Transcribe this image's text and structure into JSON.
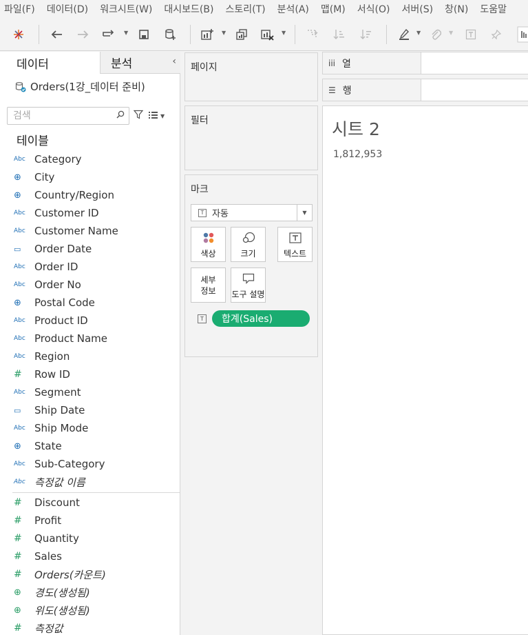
{
  "menu": [
    "파일(F)",
    "데이터(D)",
    "워크시트(W)",
    "대시보드(B)",
    "스토리(T)",
    "분석(A)",
    "맵(M)",
    "서식(O)",
    "서버(S)",
    "창(N)",
    "도움말"
  ],
  "data_pane": {
    "tab_data": "데이터",
    "tab_analysis": "분석",
    "datasource": "Orders(1강_데이터 준비)",
    "search_placeholder": "검색",
    "table_heading": "테이블",
    "dimensions": [
      {
        "icon": "Abc",
        "label": "Category"
      },
      {
        "icon": "⊕",
        "label": "City"
      },
      {
        "icon": "⊕",
        "label": "Country/Region"
      },
      {
        "icon": "Abc",
        "label": "Customer ID"
      },
      {
        "icon": "Abc",
        "label": "Customer Name"
      },
      {
        "icon": "▭",
        "label": "Order Date"
      },
      {
        "icon": "Abc",
        "label": "Order ID"
      },
      {
        "icon": "Abc",
        "label": "Order No"
      },
      {
        "icon": "⊕",
        "label": "Postal Code"
      },
      {
        "icon": "Abc",
        "label": "Product ID"
      },
      {
        "icon": "Abc",
        "label": "Product Name"
      },
      {
        "icon": "Abc",
        "label": "Region"
      },
      {
        "icon": "#",
        "label": "Row ID"
      },
      {
        "icon": "Abc",
        "label": "Segment"
      },
      {
        "icon": "▭",
        "label": "Ship Date"
      },
      {
        "icon": "Abc",
        "label": "Ship Mode"
      },
      {
        "icon": "⊕",
        "label": "State"
      },
      {
        "icon": "Abc",
        "label": "Sub-Category"
      },
      {
        "icon": "Abc",
        "label": "측정값 이름"
      }
    ],
    "measures": [
      {
        "icon": "#",
        "label": "Discount"
      },
      {
        "icon": "#",
        "label": "Profit"
      },
      {
        "icon": "#",
        "label": "Quantity"
      },
      {
        "icon": "#",
        "label": "Sales"
      },
      {
        "icon": "#",
        "label": "Orders(카운트)"
      },
      {
        "icon": "⊕",
        "label": "경도(생성됨)"
      },
      {
        "icon": "⊕",
        "label": "위도(생성됨)"
      },
      {
        "icon": "#",
        "label": "측정값"
      }
    ]
  },
  "cards": {
    "pages": "페이지",
    "filters": "필터",
    "marks": "마크",
    "mark_type": "자동",
    "mark_type_icon": "T",
    "buttons": {
      "color": "색상",
      "size": "크기",
      "text": "텍스트",
      "detail_line1": "세부",
      "detail_line2": "정보",
      "tooltip": "도구 설명"
    },
    "pill_type_icon": "T",
    "pill": "합계(Sales)"
  },
  "shelves": {
    "columns_icon": "iii",
    "columns": "열",
    "rows_icon": "☰",
    "rows": "행"
  },
  "view": {
    "title": "시트 2",
    "value": "1,812,953"
  },
  "colors": {
    "pill": "#1aac71",
    "dimension_icon": "#1f6fb5",
    "measure_icon": "#2a9d66"
  }
}
